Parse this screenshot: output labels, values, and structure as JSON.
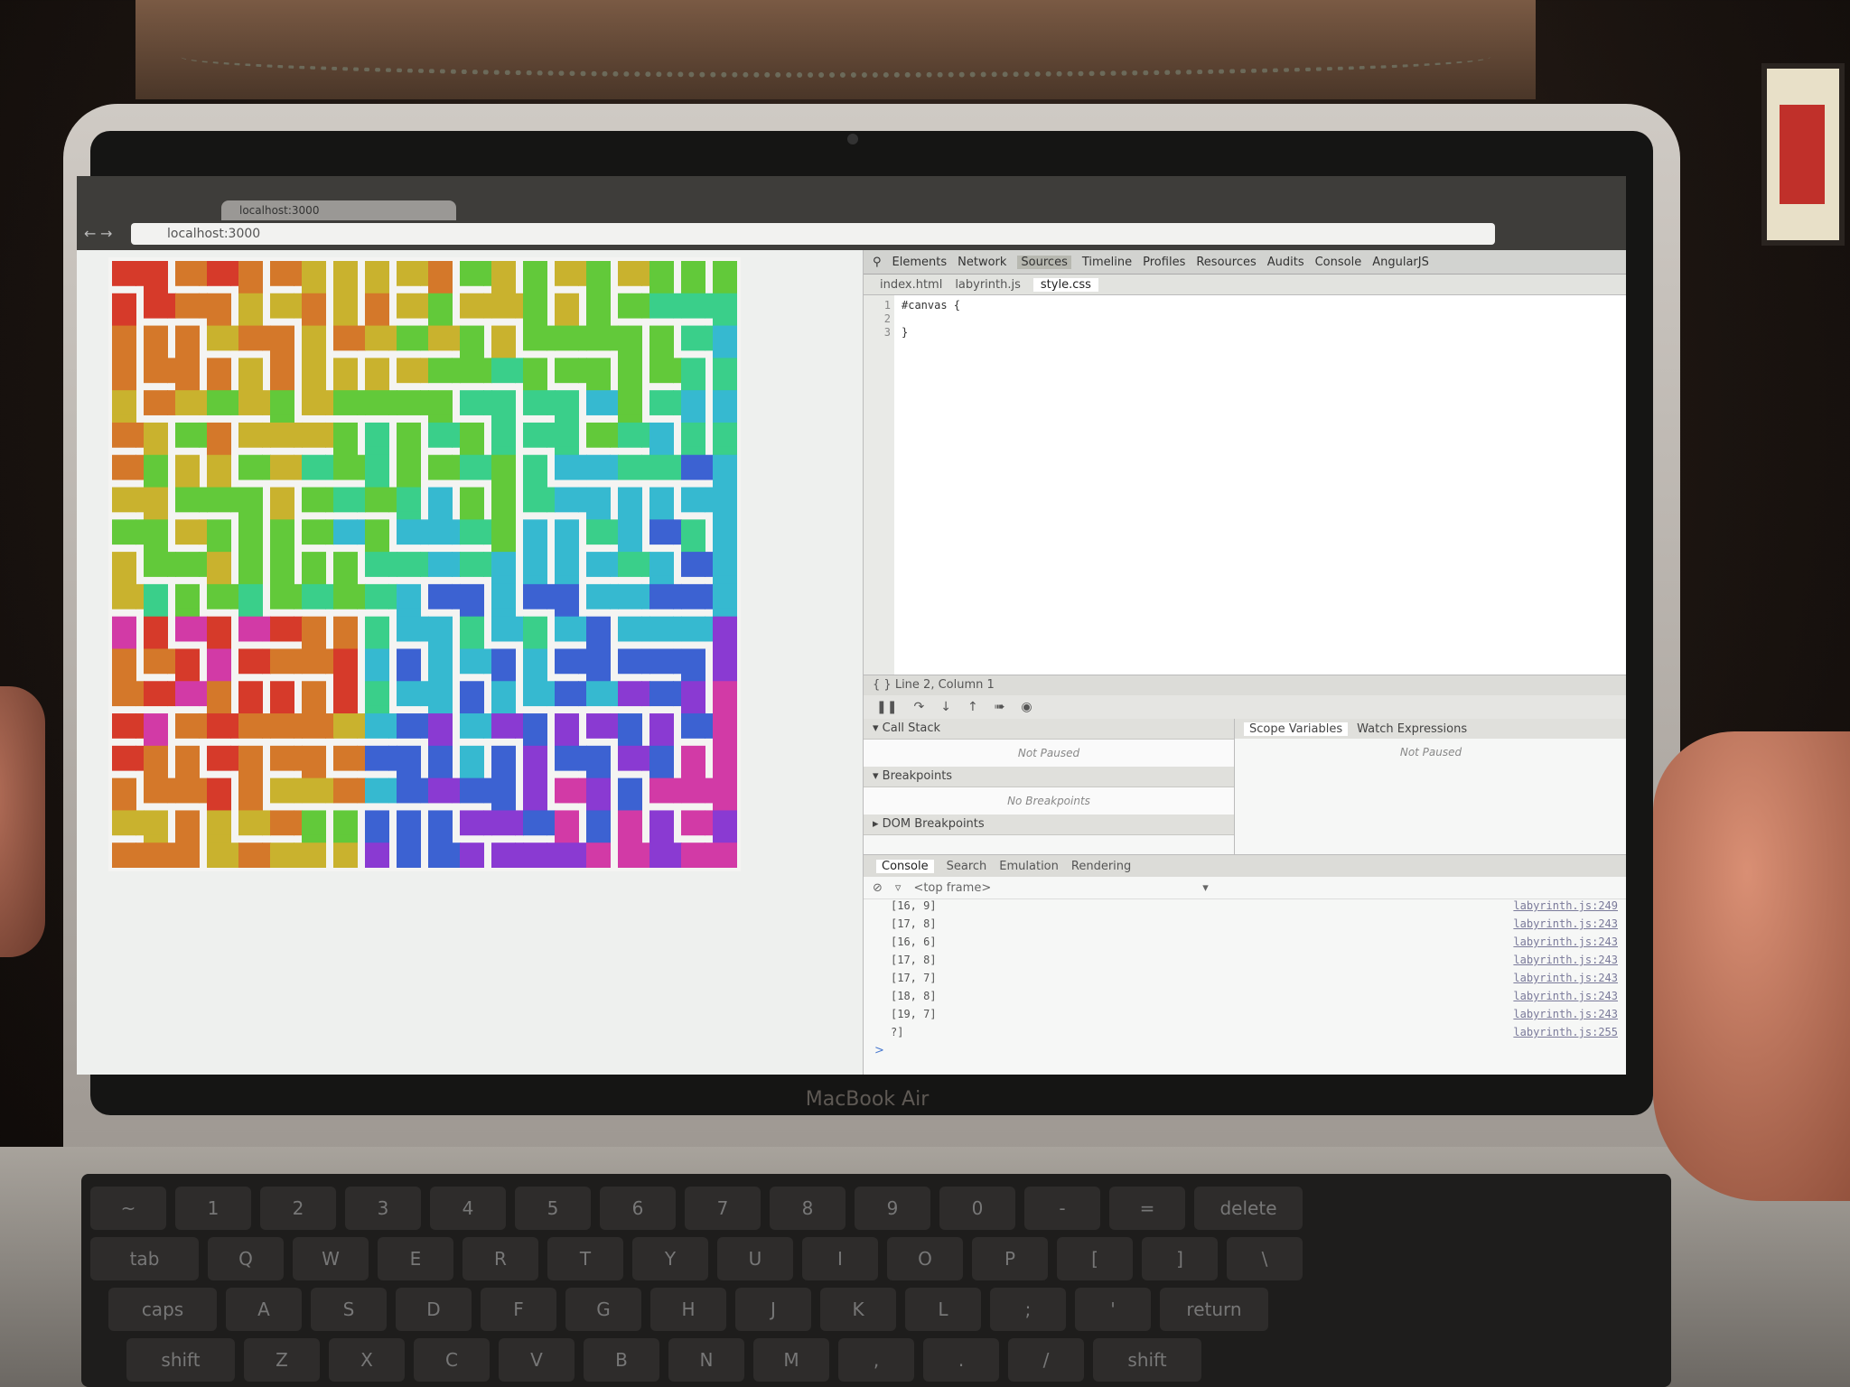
{
  "browser": {
    "tab_title": "localhost:3000",
    "address": "localhost:3000",
    "back_icon": "arrow-left-icon",
    "forward_icon": "arrow-right-icon",
    "reload_icon": "reload-icon"
  },
  "devtools": {
    "panels": [
      "Elements",
      "Network",
      "Sources",
      "Timeline",
      "Profiles",
      "Resources",
      "Audits",
      "Console",
      "AngularJS"
    ],
    "active_panel": "Sources",
    "files": [
      "index.html",
      "labyrinth.js",
      "style.css"
    ],
    "active_file": "style.css",
    "code_lines": [
      {
        "n": "1",
        "text": "#canvas {"
      },
      {
        "n": "2",
        "text": ""
      },
      {
        "n": "3",
        "text": "}"
      }
    ],
    "status": "Line 2, Column 1",
    "call_stack": {
      "title": "Call Stack",
      "body": "Not Paused"
    },
    "breakpoints": {
      "title": "Breakpoints",
      "body": "No Breakpoints"
    },
    "dom_breakpoints": {
      "title": "DOM Breakpoints"
    },
    "right_tabs": [
      "Scope Variables",
      "Watch Expressions"
    ],
    "scope_body": "Not Paused",
    "drawer_tabs": [
      "Console",
      "Search",
      "Emulation",
      "Rendering"
    ],
    "frame_select": "<top frame>",
    "console_lines": [
      {
        "msg": "[16, 9]",
        "src": "labyrinth.js:249"
      },
      {
        "msg": "[17, 8]",
        "src": "labyrinth.js:243"
      },
      {
        "msg": "[16, 6]",
        "src": "labyrinth.js:243"
      },
      {
        "msg": "[17, 8]",
        "src": "labyrinth.js:243"
      },
      {
        "msg": "[17, 7]",
        "src": "labyrinth.js:243"
      },
      {
        "msg": "[18, 8]",
        "src": "labyrinth.js:243"
      },
      {
        "msg": "[19, 7]",
        "src": "labyrinth.js:243"
      },
      {
        "msg": "?]",
        "src": "labyrinth.js:255"
      }
    ],
    "prompt": ">"
  },
  "laptop": {
    "brand": "MacBook Air"
  },
  "keys": {
    "row1": [
      "~",
      "1",
      "2",
      "3",
      "4",
      "5",
      "6",
      "7",
      "8",
      "9",
      "0",
      "-",
      "=",
      "delete"
    ],
    "row2": [
      "tab",
      "Q",
      "W",
      "E",
      "R",
      "T",
      "Y",
      "U",
      "I",
      "O",
      "P",
      "[",
      "]",
      "\\"
    ],
    "row3": [
      "caps",
      "A",
      "S",
      "D",
      "F",
      "G",
      "H",
      "J",
      "K",
      "L",
      ";",
      "'",
      "return"
    ],
    "row4": [
      "shift",
      "Z",
      "X",
      "C",
      "V",
      "B",
      "N",
      "M",
      ",",
      ".",
      "/",
      "shift"
    ]
  },
  "maze_colors": [
    "#d63a2a",
    "#d4782a",
    "#c9b22e",
    "#62c93a",
    "#3acf8a",
    "#36b9d0",
    "#3c62d2",
    "#8a3ad2",
    "#d23aa6"
  ]
}
